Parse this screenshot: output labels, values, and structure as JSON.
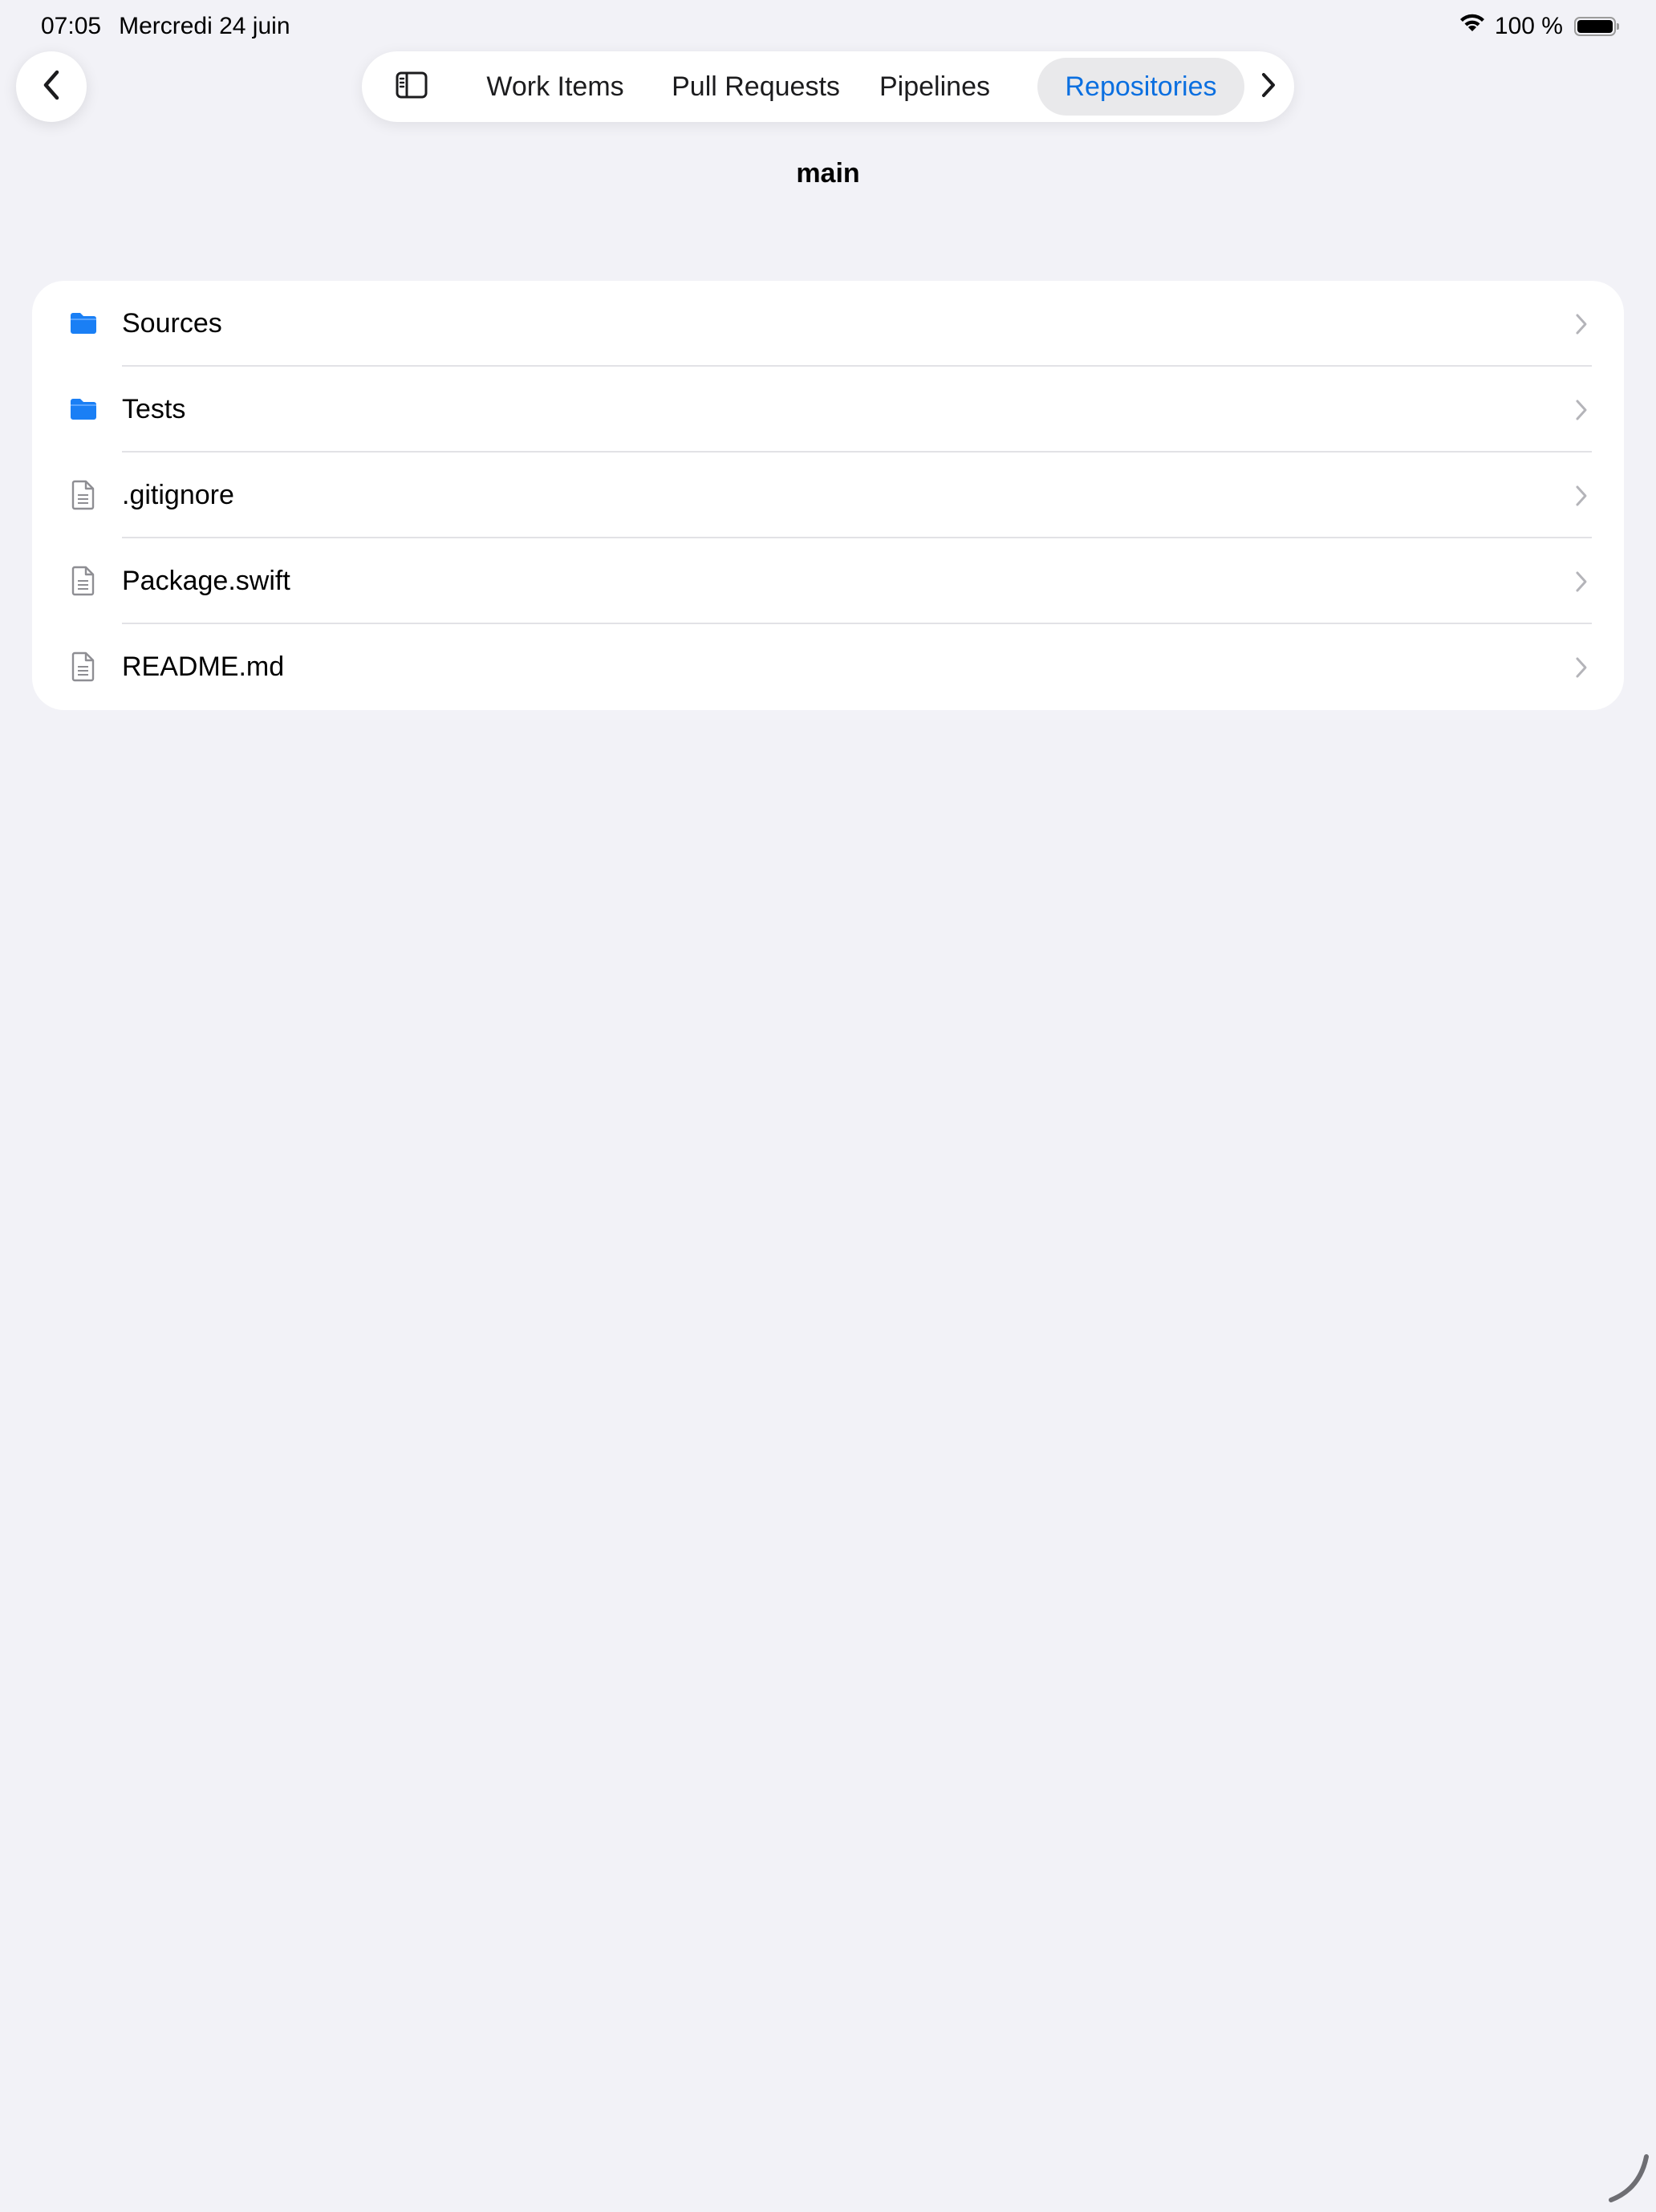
{
  "status_bar": {
    "time": "07:05",
    "date": "Mercredi 24 juin",
    "battery": "100 %"
  },
  "nav": {
    "back_icon": "chevron-left-icon"
  },
  "tabs": [
    {
      "label": "Work Items",
      "active": false
    },
    {
      "label": "Pull Requests",
      "active": false
    },
    {
      "label": "Pipelines",
      "active": false
    },
    {
      "label": "Repositories",
      "active": true
    }
  ],
  "page": {
    "title": "main"
  },
  "files": [
    {
      "name": "Sources",
      "kind": "folder",
      "icon": "folder-icon"
    },
    {
      "name": "Tests",
      "kind": "folder",
      "icon": "folder-icon"
    },
    {
      "name": ".gitignore",
      "kind": "file",
      "icon": "document-icon"
    },
    {
      "name": "Package.swift",
      "kind": "file",
      "icon": "document-icon"
    },
    {
      "name": "README.md",
      "kind": "file",
      "icon": "document-icon"
    }
  ],
  "colors": {
    "accent": "#0a6fe0",
    "folder": "#1a7ff5",
    "background": "#f2f2f7"
  }
}
